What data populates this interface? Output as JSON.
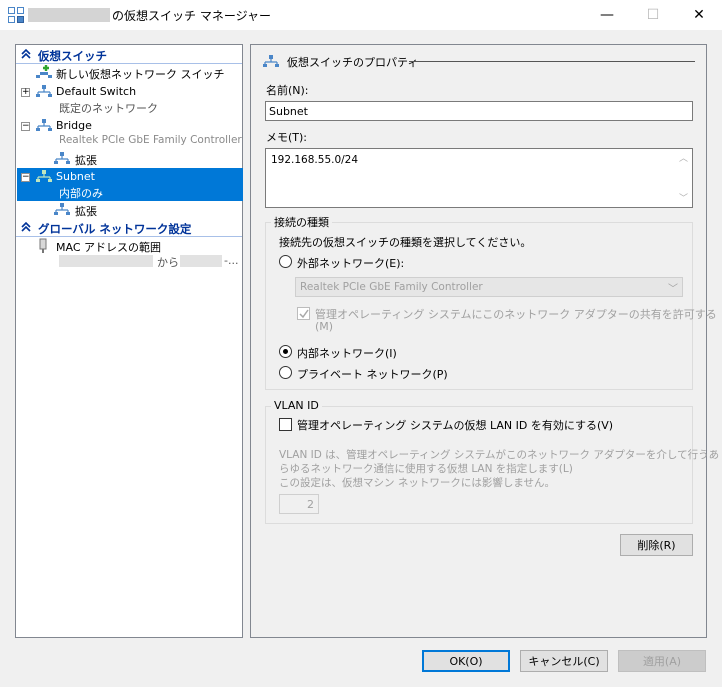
{
  "window": {
    "title": "の仮想スイッチ マネージャー",
    "controls": {
      "minimize": "—",
      "maximize": "☐",
      "close": "✕"
    }
  },
  "tree": {
    "section_switches": "仮想スイッチ",
    "new_switch": "新しい仮想ネットワーク スイッチ",
    "items": [
      {
        "name": "Default Switch",
        "sub": "既定のネットワーク"
      },
      {
        "name": "Bridge",
        "sub": "Realtek PCIe GbE Family Controller",
        "child": "拡張"
      },
      {
        "name": "Subnet",
        "sub": "内部のみ",
        "child": "拡張"
      }
    ],
    "section_global": "グローバル ネットワーク設定",
    "mac_range": "MAC アドレスの範囲",
    "mac_from": "から",
    "mac_ellipsis": "-..."
  },
  "properties": {
    "header": "仮想スイッチのプロパティ",
    "name_label": "名前(N):",
    "name_value": "Subnet",
    "memo_label": "メモ(T):",
    "memo_value": "192.168.55.0/24",
    "conn_group": "接続の種類",
    "conn_desc": "接続先の仮想スイッチの種類を選択してください。",
    "external": "外部ネットワーク(E):",
    "adapter": "Realtek PCIe GbE Family Controller",
    "allow_mgmt": "管理オペレーティング システムにこのネットワーク アダプターの共有を許可する",
    "allow_mgmt_key": "(M)",
    "internal": "内部ネットワーク(I)",
    "private": "プライベート ネットワーク(P)",
    "selected_type": "internal",
    "vlan_group": "VLAN ID",
    "vlan_enable": "管理オペレーティング システムの仮想 LAN ID を有効にする(V)",
    "vlan_desc1": "VLAN ID は、管理オペレーティング システムがこのネットワーク アダプターを介して行うあ",
    "vlan_desc2": "らゆるネットワーク通信に使用する仮想 LAN を指定します(L)",
    "vlan_desc3": "この設定は、仮想マシン ネットワークには影響しません。",
    "vlan_value": "2",
    "delete": "削除(R)"
  },
  "footer": {
    "ok": "OK(O)",
    "cancel": "キャンセル(C)",
    "apply": "適用(A)"
  },
  "colors": {
    "selection": "#0078d7",
    "section_header": "#003399"
  }
}
